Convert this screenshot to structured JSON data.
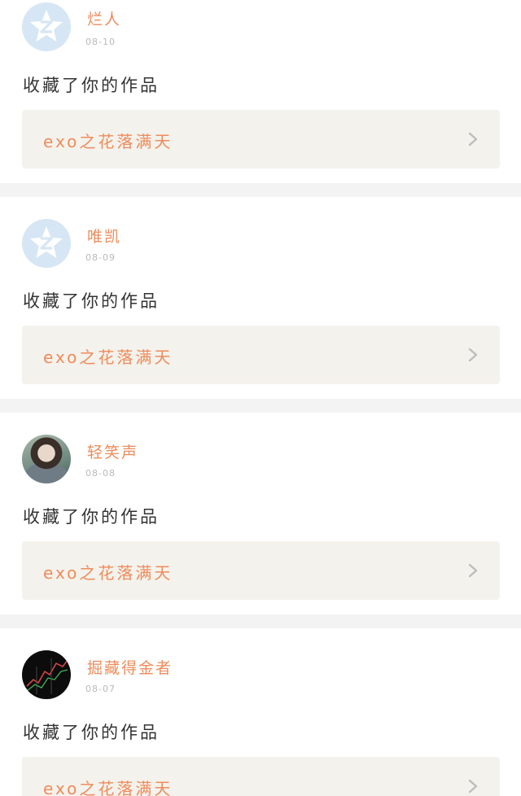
{
  "posts": [
    {
      "username": "烂人",
      "date": "08-10",
      "action": "收藏了你的作品",
      "work_title": "exo之花落满天",
      "avatar": "default-qq-avatar"
    },
    {
      "username": "唯凯",
      "date": "08-09",
      "action": "收藏了你的作品",
      "work_title": "exo之花落满天",
      "avatar": "default-qq-avatar"
    },
    {
      "username": "轻笑声",
      "date": "08-08",
      "action": "收藏了你的作品",
      "work_title": "exo之花落满天",
      "avatar": "user-photo"
    },
    {
      "username": "掘藏得金者",
      "date": "08-07",
      "action": "收藏了你的作品",
      "work_title": "exo之花落满天",
      "avatar": "user-photo"
    }
  ],
  "colors": {
    "accent": "#ef8c5c",
    "link_card_bg": "#f4f2ec",
    "separator": "#f3f3f3",
    "default_avatar": "#d6e6f4"
  },
  "icons": {
    "arrow": "chevron-right-icon",
    "default_avatar": "star-avatar-icon"
  }
}
